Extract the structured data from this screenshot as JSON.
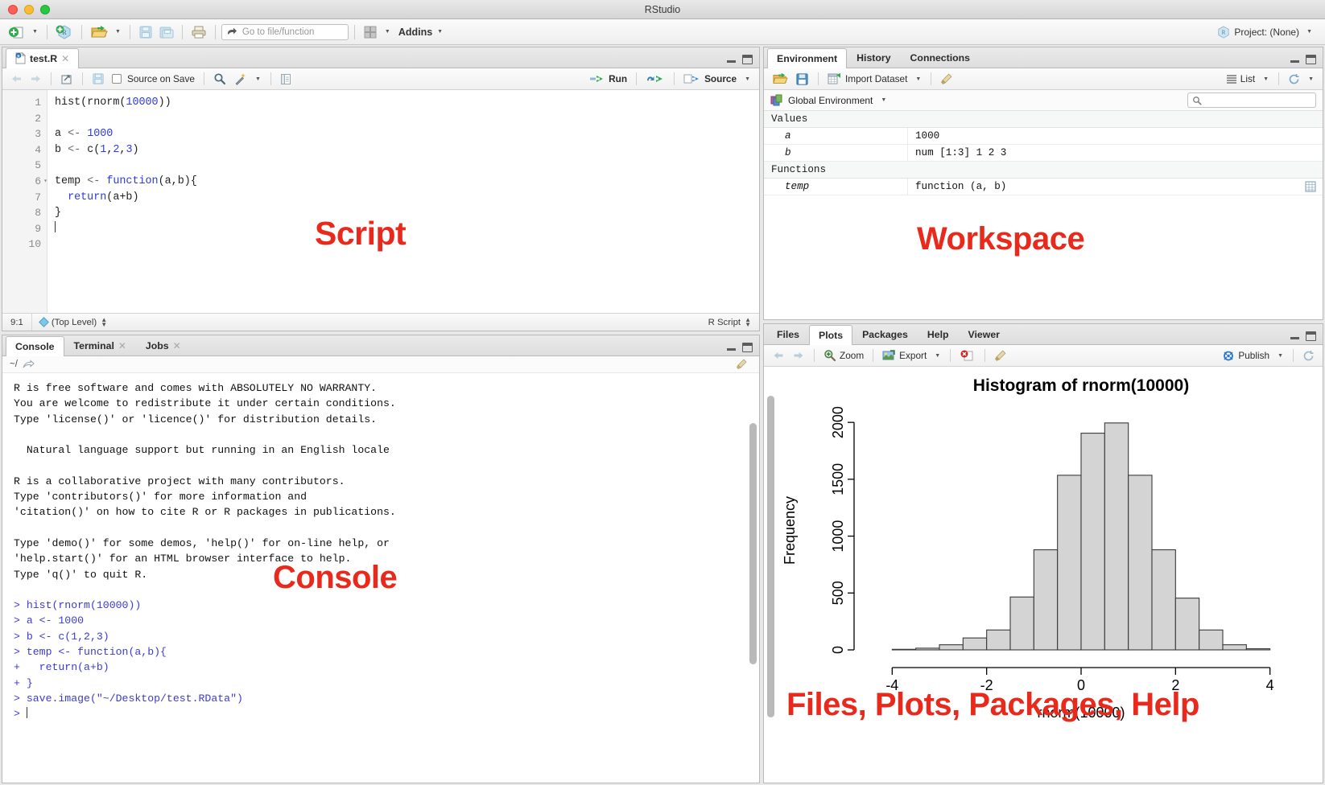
{
  "window": {
    "title": "RStudio"
  },
  "toolbar": {
    "goto_placeholder": "Go to file/function",
    "addins_label": "Addins",
    "project_label": "Project: (None)"
  },
  "source": {
    "tab_label": "test.R",
    "tools": {
      "source_on_save": "Source on Save",
      "run": "Run",
      "source": "Source"
    },
    "lines": [
      {
        "n": "1",
        "fold": false,
        "code": "hist(rnorm(10000))"
      },
      {
        "n": "2",
        "fold": false,
        "code": ""
      },
      {
        "n": "3",
        "fold": false,
        "code": "a <- 1000"
      },
      {
        "n": "4",
        "fold": false,
        "code": "b <- c(1,2,3)"
      },
      {
        "n": "5",
        "fold": false,
        "code": ""
      },
      {
        "n": "6",
        "fold": true,
        "code": "temp <- function(a,b){"
      },
      {
        "n": "7",
        "fold": false,
        "code": "  return(a+b)"
      },
      {
        "n": "8",
        "fold": false,
        "code": "}"
      },
      {
        "n": "9",
        "fold": false,
        "code": ""
      },
      {
        "n": "10",
        "fold": false,
        "code": ""
      }
    ],
    "status": {
      "cursor": "9:1",
      "scope": "(Top Level)",
      "type": "R Script"
    },
    "annotation": "Script"
  },
  "console": {
    "tabs": [
      {
        "label": "Console",
        "closable": false,
        "active": true
      },
      {
        "label": "Terminal",
        "closable": true,
        "active": false
      },
      {
        "label": "Jobs",
        "closable": true,
        "active": false
      }
    ],
    "path": "~/",
    "output": [
      "R is free software and comes with ABSOLUTELY NO WARRANTY.",
      "You are welcome to redistribute it under certain conditions.",
      "Type 'license()' or 'licence()' for distribution details.",
      "",
      "  Natural language support but running in an English locale",
      "",
      "R is a collaborative project with many contributors.",
      "Type 'contributors()' for more information and",
      "'citation()' on how to cite R or R packages in publications.",
      "",
      "Type 'demo()' for some demos, 'help()' for on-line help, or",
      "'help.start()' for an HTML browser interface to help.",
      "Type 'q()' to quit R.",
      ""
    ],
    "commands": [
      "> hist(rnorm(10000))",
      "> a <- 1000",
      "> b <- c(1,2,3)",
      "> temp <- function(a,b){",
      "+   return(a+b)",
      "+ }",
      "> save.image(\"~/Desktop/test.RData\")",
      "> "
    ],
    "annotation": "Console"
  },
  "environment": {
    "tabs": [
      {
        "label": "Environment",
        "active": true
      },
      {
        "label": "History",
        "active": false
      },
      {
        "label": "Connections",
        "active": false
      }
    ],
    "tools": {
      "import_dataset": "Import Dataset",
      "view_mode": "List"
    },
    "scope": "Global Environment",
    "search_value": "",
    "groups": [
      {
        "name": "Values",
        "items": [
          {
            "key": "a",
            "value": "1000",
            "has_grid_icon": false
          },
          {
            "key": "b",
            "value": "num [1:3] 1 2 3",
            "has_grid_icon": false
          }
        ]
      },
      {
        "name": "Functions",
        "items": [
          {
            "key": "temp",
            "value": "function (a, b)",
            "has_grid_icon": true
          }
        ]
      }
    ],
    "annotation": "Workspace"
  },
  "plots": {
    "tabs": [
      {
        "label": "Files",
        "active": false
      },
      {
        "label": "Plots",
        "active": true
      },
      {
        "label": "Packages",
        "active": false
      },
      {
        "label": "Help",
        "active": false
      },
      {
        "label": "Viewer",
        "active": false
      }
    ],
    "tools": {
      "zoom": "Zoom",
      "export": "Export",
      "publish": "Publish"
    },
    "annotation": "Files, Plots, Packages, Help"
  },
  "chart_data": {
    "type": "bar",
    "title": "Histogram of rnorm(10000)",
    "xlabel": "rnorm(10000)",
    "ylabel": "Frequency",
    "xlim": [
      -4.5,
      4.5
    ],
    "ylim": [
      0,
      2100
    ],
    "yticks": [
      0,
      500,
      1000,
      1500,
      2000
    ],
    "xticks": [
      -4,
      -2,
      0,
      2,
      4
    ],
    "grid": false,
    "bin_width": 0.5,
    "bin_starts": [
      -4.0,
      -3.5,
      -3.0,
      -2.5,
      -2.0,
      -1.5,
      -1.0,
      -0.5,
      0.0,
      0.5,
      1.0,
      1.5,
      2.0,
      2.5,
      3.0,
      3.5
    ],
    "categories": [
      "-4.0",
      "-3.5",
      "-3.0",
      "-2.5",
      "-2.0",
      "-1.5",
      "-1.0",
      "-0.5",
      "0.0",
      "0.5",
      "1.0",
      "1.5",
      "2.0",
      "2.5",
      "3.0",
      "3.5"
    ],
    "values": [
      5,
      15,
      45,
      105,
      175,
      465,
      880,
      1535,
      1905,
      1995,
      1535,
      880,
      455,
      175,
      45,
      10
    ],
    "bar_fill": "#d4d4d4",
    "bar_stroke": "#3a3a3a"
  },
  "colors": {
    "annotation_red": "#e8291c",
    "code_blue": "#2c3bd6",
    "console_blue": "#3a3ad6"
  }
}
